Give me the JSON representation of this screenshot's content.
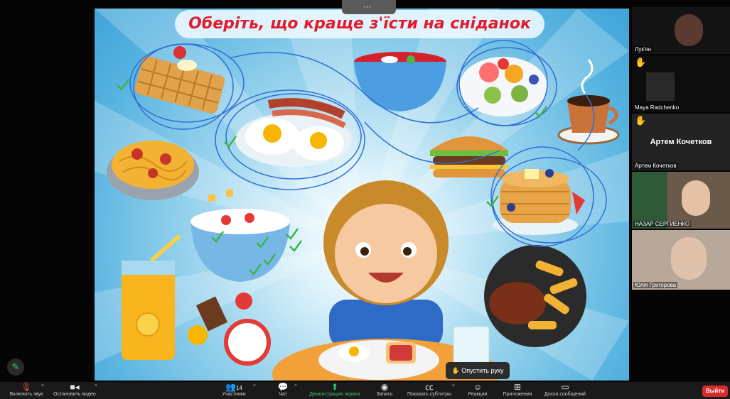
{
  "slide": {
    "title": "Оберіть, що краще з'їсти на сніданок"
  },
  "top_handle_label": "⋯",
  "participants": [
    {
      "name": "Лук'ян",
      "hand_raised": false
    },
    {
      "name": "Maya Radchenko",
      "hand_raised": true
    },
    {
      "name": "Артем Кочетков",
      "display": "Артем Кочетков",
      "hand_raised": true
    },
    {
      "name": "НАЗАР СЕРГИЕНКО",
      "hand_raised": false
    },
    {
      "name": "Юлія Григорова",
      "hand_raised": false
    }
  ],
  "floating": {
    "lower_hand_label": "Опустить руку"
  },
  "toolbar": {
    "participants_count": "14",
    "items": [
      {
        "label": "Включить звук",
        "icon": "microphone-muted-icon"
      },
      {
        "label": "Остановить видео",
        "icon": "video-camera-icon"
      },
      {
        "label": "Участники",
        "icon": "participants-icon"
      },
      {
        "label": "Чат",
        "icon": "chat-icon"
      },
      {
        "label": "Демонстрация экрана",
        "icon": "share-screen-icon"
      },
      {
        "label": "Запись",
        "icon": "record-icon"
      },
      {
        "label": "Показать субтитры",
        "icon": "captions-icon"
      },
      {
        "label": "Реакции",
        "icon": "reactions-icon"
      },
      {
        "label": "Приложения",
        "icon": "apps-icon"
      },
      {
        "label": "Доска сообщений",
        "icon": "whiteboard-icon"
      }
    ],
    "leave_label": "Выйти"
  },
  "colors": {
    "title_red": "#e21b2d",
    "toolbar_bg": "#1a1a1a",
    "leave_red": "#d92b2b",
    "annotation_blue": "#2f6fd6",
    "check_green": "#3bb54a"
  }
}
